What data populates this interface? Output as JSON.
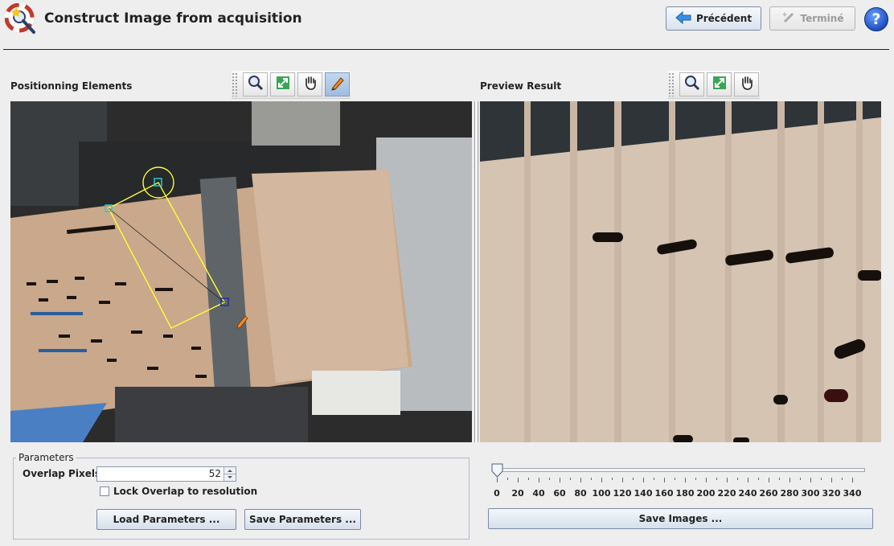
{
  "window": {
    "title": "Construct Image from acquisition"
  },
  "header": {
    "previous_label": "Précédent",
    "finish_label": "Terminé",
    "help_label": "?"
  },
  "left_panel": {
    "title": "Positionning Elements",
    "tools": [
      "zoom-icon",
      "fit-icon",
      "pan-hand-icon",
      "pencil-icon"
    ],
    "active_tool": "pencil-icon"
  },
  "right_panel": {
    "title": "Preview Result",
    "tools": [
      "zoom-icon",
      "fit-icon",
      "pan-hand-icon"
    ]
  },
  "parameters": {
    "legend": "Parameters",
    "overlap_label": "Overlap Pixels",
    "overlap_value": "52",
    "lock_label": "Lock Overlap to resolution",
    "lock_checked": false,
    "load_label": "Load Parameters ...",
    "save_label": "Save Parameters ..."
  },
  "slider": {
    "value": 0,
    "labels": [
      "0",
      "20",
      "40",
      "60",
      "80",
      "100",
      "120",
      "140",
      "160",
      "180",
      "200",
      "220",
      "240",
      "260",
      "280",
      "300",
      "320",
      "340"
    ]
  },
  "save_images_label": "Save Images ...",
  "colors": {
    "overlay": "#ffff33",
    "accent": "#3c78c8"
  }
}
